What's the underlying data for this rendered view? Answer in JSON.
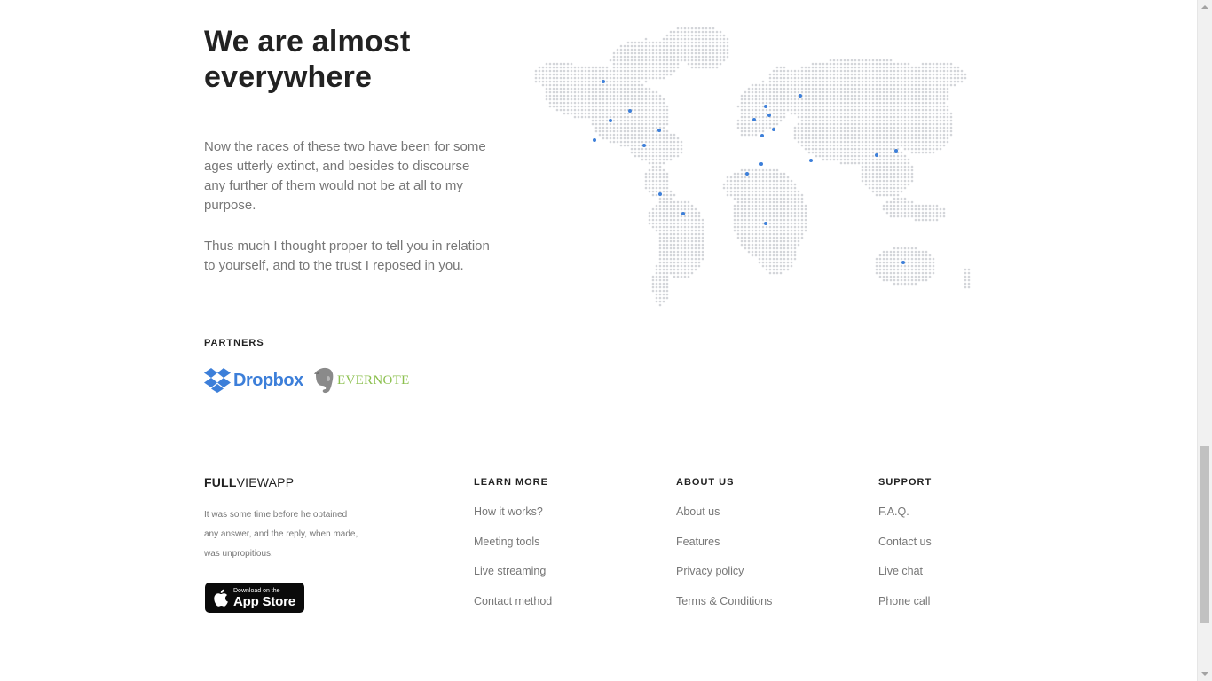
{
  "hero": {
    "title": "We are almost everywhere",
    "paragraph_1": "Now the races of these two have been for some ages utterly extinct, and besides to discourse any further of them would not be at all to my purpose.",
    "paragraph_2": "Thus much I thought proper to tell you in relation to yourself, and to the trust I reposed in you."
  },
  "partners": {
    "label": "PARTNERS",
    "dropbox": "Dropbox",
    "evernote": "EVERNOTE"
  },
  "map": {
    "dot_color": "#d3d5d9",
    "marker_color": "#3d7fd9"
  },
  "footer": {
    "brand_bold": "FULL",
    "brand_rest": "VIEWAPP",
    "description": "It was some time before he obtained any answer, and the reply, when made, was unpropitious.",
    "app_store_small": "Download on the",
    "app_store_big": "App Store",
    "columns": [
      {
        "title": "LEARN MORE",
        "links": [
          "How it works?",
          "Meeting tools",
          "Live streaming",
          "Contact method"
        ]
      },
      {
        "title": "ABOUT US",
        "links": [
          "About us",
          "Features",
          "Privacy policy",
          "Terms & Conditions"
        ]
      },
      {
        "title": "SUPPORT",
        "links": [
          "F.A.Q.",
          "Contact us",
          "Live chat",
          "Phone call"
        ]
      }
    ]
  }
}
